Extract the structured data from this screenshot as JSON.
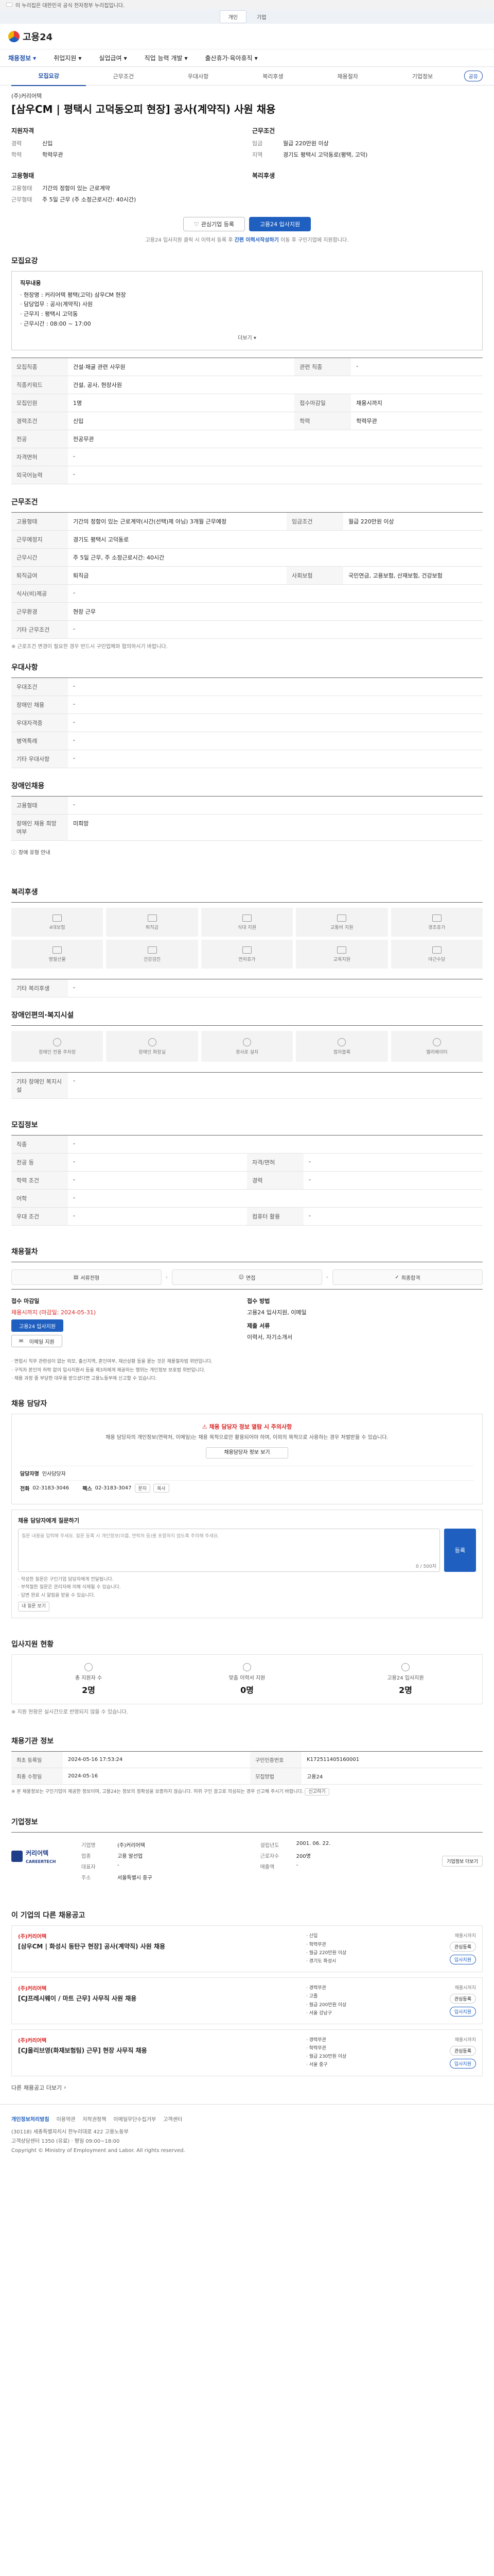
{
  "notice": "이 누리집은 대한민국 공식 전자정부 누리집입니다.",
  "gov_tabs": [
    "개인",
    "기업"
  ],
  "brand": "고용24",
  "gnb": [
    "채용정보",
    "취업지원",
    "실업급여",
    "직업 능력 개발",
    "출산휴가·육아휴직"
  ],
  "detail_tabs": [
    "모집요강",
    "근무조건",
    "우대사항",
    "복리후생",
    "채용절차",
    "기업정보"
  ],
  "share_label": "공유",
  "job": {
    "company": "(주)커리어텍",
    "title": "[삼우CM | 평택시 고덕동오피 현장] 공사(계약직) 사원 채용",
    "qualifications_title": "지원자격",
    "qualifications": [
      {
        "k": "경력",
        "v": "신입"
      },
      {
        "k": "학력",
        "v": "학력무관"
      }
    ],
    "conditions_title": "근무조건",
    "conditions": [
      {
        "k": "임금",
        "v": "월급 220만원 이상"
      },
      {
        "k": "지역",
        "v": "경기도 평택시 고덕동로(평택, 고덕)"
      }
    ],
    "employ_title": "고용형태",
    "employ": [
      {
        "k": "고용형태",
        "v": "기간의 정함이 있는 근로계약"
      },
      {
        "k": "근무형태",
        "v": "주 5일 근무 (주 소정근로시간: 40시간)"
      }
    ],
    "worktime_title": "복리후생",
    "btn_interest": "관심기업 등록",
    "btn_apply": "고용24 입사지원",
    "apply_note_prefix": "고용24 입사지원 클릭 시 이력서 등록 후 ",
    "apply_note_bold": "간편 이력서작성하기",
    "apply_note_suffix": " 이동 후 구인기업에 지원합니다."
  },
  "recruit": {
    "title": "모집요강",
    "duty_label": "직무내용",
    "duties": [
      "· 현장명 : 커리어텍 평택(고덕) 삼우CM 현장",
      "· 담당업무 : 공사(계약직) 사원",
      "· 근무지 : 평택시 고덕동",
      "· 근무시간 : 08:00 ~ 17:00"
    ],
    "toggle": "더보기",
    "table": [
      {
        "k": "모집직종",
        "v": "건설·채굴 관련 사무원",
        "k2": "관련 직종",
        "v2": "-"
      },
      {
        "k": "직종키워드",
        "v": "건설, 공사, 현장사원",
        "k2": "",
        "v2": ""
      },
      {
        "k": "모집인원",
        "v": "1명",
        "k2": "접수마감일",
        "v2": "채용시까지"
      },
      {
        "k": "경력조건",
        "v": "신입",
        "k2": "학력",
        "v2": "학력무관"
      },
      {
        "k": "전공",
        "v": "전공무관",
        "k2": "",
        "v2": ""
      },
      {
        "k": "자격면허",
        "v": "-",
        "k2": "",
        "v2": ""
      },
      {
        "k": "외국어능력",
        "v": "-",
        "k2": "",
        "v2": ""
      }
    ]
  },
  "work": {
    "title": "근무조건",
    "table": [
      {
        "k": "고용형태",
        "v": "기간의 정함이 있는 근로계약(시간(선택)제 아님) 3개월 근무예정",
        "k2": "임금조건",
        "v2": "월급 220만원 이상"
      },
      {
        "k": "근무예정지",
        "v": "경기도 평택시 고덕동로",
        "k2": "",
        "v2": ""
      },
      {
        "k": "근무시간",
        "v": "주 5일 근무, 주 소정근로시간: 40시간",
        "k2": "",
        "v2": ""
      },
      {
        "k": "퇴직급여",
        "v": "퇴직금",
        "k2": "사회보험",
        "v2": "국민연금, 고용보험, 산재보험, 건강보험"
      },
      {
        "k": "식사(비)제공",
        "v": "-",
        "k2": "",
        "v2": ""
      },
      {
        "k": "근무환경",
        "v": "현장 근무",
        "k2": "",
        "v2": ""
      },
      {
        "k": "기타 근무조건",
        "v": "-",
        "k2": "",
        "v2": ""
      }
    ],
    "note": "※ 근로조건 변경이 필요한 경우 반드시 구인업체와 협의하시기 바랍니다."
  },
  "pref": {
    "title": "우대사항",
    "table": [
      {
        "k": "우대조건",
        "v": "-"
      },
      {
        "k": "장애인 채용",
        "v": "-"
      },
      {
        "k": "우대자격증",
        "v": "-"
      },
      {
        "k": "병역특례",
        "v": "-"
      },
      {
        "k": "기타 우대사항",
        "v": "-"
      }
    ]
  },
  "disability": {
    "title": "장애인채용",
    "table": [
      {
        "k": "고용형태",
        "v": "-"
      },
      {
        "k": "장애인 채용 희망 여부",
        "v": "미희망"
      }
    ],
    "link": "장애 유형 안내"
  },
  "welfare": {
    "title": "복리후생",
    "items": [
      "4대보험",
      "퇴직금",
      "식대 지원",
      "교통비 지원",
      "경조휴가",
      "명절선물",
      "건강검진",
      "연차휴가",
      "교육지원",
      "야근수당"
    ],
    "other_label": "기타 복리후생",
    "other_value": "-"
  },
  "disabled_welfare": {
    "title": "장애인편의·복지시설",
    "items": [
      "장애인 전용 주차장",
      "장애인 화장실",
      "경사로 설치",
      "점자블록",
      "엘리베이터"
    ],
    "other_label": "기타 장애인 복지시설",
    "other_value": "-"
  },
  "company_size": {
    "title": "모집정보",
    "table": [
      {
        "k": "직종",
        "v": "-",
        "k2": "",
        "v2": ""
      },
      {
        "k": "전공 등",
        "v": "-",
        "k2": "자격/면허",
        "v2": "-"
      },
      {
        "k": "학력 조건",
        "v": "-",
        "k2": "경력",
        "v2": "-"
      },
      {
        "k": "어학",
        "v": "-",
        "k2": "",
        "v2": ""
      },
      {
        "k": "우대 조건",
        "v": "-",
        "k2": "컴퓨터 활용",
        "v2": "-"
      }
    ]
  },
  "process": {
    "title": "채용절차",
    "steps": [
      "서류전형",
      "면접",
      "최종합격"
    ],
    "apply_label": "접수 마감일",
    "apply_value": "채용시까지 (마감일: 2024-05-31)",
    "method_label": "접수 방법",
    "method_value": "고용24 입사지원, 이메일",
    "docs_label": "제출 서류",
    "docs_value": "이력서, 자기소개서",
    "btn_apply": "고용24 입사지원",
    "btn_email": "이메일 지원",
    "notes": [
      "· 면접시 직무 관련성이 없는 외모, 출신지역, 혼인여부, 재산상황 등을 묻는 것은 채용절차법 위반입니다.",
      "· 구직자 본인의 허락 없이 입사지원서 등을 제3자에게 제공하는 행위는 개인정보 보호법 위반입니다.",
      "· 채용 과정 중 부당한 대우를 받으셨다면 고용노동부에 신고할 수 있습니다."
    ]
  },
  "contact": {
    "title": "채용 담당자",
    "alert_title": "채용 담당자 정보 열람 시 주의사항",
    "alert_text": "채용 담당자의 개인정보(연락처, 이메일)는 채용 목적으로만 활용되어야 하며, 이외의 목적으로 사용하는 경우 처벌받을 수 있습니다.",
    "btn": "채용담당자 정보 보기",
    "manager_label": "담당자명",
    "manager_value": "인사담당자",
    "phone_label": "전화",
    "phone_value": "02-3183-3046",
    "fax_label": "팩스",
    "fax_value": "02-3183-3047",
    "chips": [
      "문자",
      "복사"
    ]
  },
  "qna": {
    "title": "채용 담당자에게 질문하기",
    "placeholder": "질문 내용을 입력해 주세요. 질문 등록 시 개인정보(이름, 연락처 등)를 포함하지 않도록 주의해 주세요.",
    "count": "0 / 500자",
    "btn": "등록",
    "notes": [
      "· 작성한 질문은 구인기업 담당자에게 전달됩니다.",
      "· 부적절한 질문은 관리자에 의해 삭제될 수 있습니다.",
      "· 답변 완료 시 알림을 받을 수 있습니다."
    ],
    "my_btn": "내 질문 보기"
  },
  "stats": {
    "title": "입사지원 현황",
    "items": [
      {
        "label": "총 지원자 수",
        "value": "2명"
      },
      {
        "label": "맞춤 이력서 지원",
        "value": "0명"
      },
      {
        "label": "고용24 입사지원",
        "value": "2명"
      }
    ],
    "note": "※ 지원 현황은 실시간으로 반영되지 않을 수 있습니다."
  },
  "meta": {
    "title": "채용기관 정보",
    "rows": [
      {
        "k": "최초 등록일",
        "v": "2024-05-16 17:53:24",
        "k2": "구인인증번호",
        "v2": "K172511405160001"
      },
      {
        "k": "최종 수정일",
        "v": "2024-05-16",
        "k2": "모집방법",
        "v2": "고용24"
      }
    ],
    "note": "※ 본 채용정보는 구인기업이 제공한 정보이며, 고용24는 정보의 정확성을 보증하지 않습니다. 허위 구인 광고로 의심되는 경우 신고해 주시기 바랍니다.",
    "report_btn": "신고하기"
  },
  "company": {
    "title": "기업정보",
    "logo_text": "커리어텍",
    "logo_sub": "CAREERTECH",
    "rows": [
      {
        "k": "기업명",
        "v": "(주)커리어텍",
        "k2": "설립년도",
        "v2": "2001. 06. 22."
      },
      {
        "k": "업종",
        "v": "고용 알선업",
        "k2": "근로자수",
        "v2": "200명"
      },
      {
        "k": "대표자",
        "v": "-",
        "k2": "매출액",
        "v2": "-"
      },
      {
        "k": "주소",
        "v": "서울특별시 중구",
        "k2": "",
        "v2": ""
      }
    ],
    "cta": "기업정보 더보기"
  },
  "related": {
    "title": "이 기업의 다른 채용공고",
    "items": [
      {
        "company": "(주)커리어텍",
        "title": "[삼우CM | 화성시 동탄구 현장] 공사(계약직) 사원 채용",
        "meta": [
          "· 신입",
          "· 학력무관",
          "· 월급 220만원 이상",
          "· 경기도 화성시"
        ],
        "dday": "채용시까지"
      },
      {
        "company": "(주)커리어텍",
        "title": "[CJ프레시웨이 / 마트 근무] 사무직 사원 채용",
        "meta": [
          "· 경력무관",
          "· 고졸",
          "· 월급 200만원 이상",
          "· 서울 강남구"
        ],
        "dday": "채용시까지"
      },
      {
        "company": "(주)커리어텍",
        "title": "[CJ올리브영(화재보험팀) 근무] 현장 사무직 채용",
        "meta": [
          "· 경력무관",
          "· 학력무관",
          "· 월급 230만원 이상",
          "· 서울 중구"
        ],
        "dday": "채용시까지"
      }
    ],
    "btn_save": "관심등록",
    "btn_apply": "입사지원",
    "more_link": "다른 채용공고 더보기"
  },
  "footer": {
    "links": [
      "개인정보처리방침",
      "이용약관",
      "저작권정책",
      "이메일무단수집거부",
      "고객센터"
    ],
    "addr1": "(30118) 세종특별자치시 한누리대로 422 고용노동부",
    "addr2": "고객상담센터 1350 (유료) · 평일 09:00~18:00",
    "copy": "Copyright © Ministry of Employment and Labor. All rights reserved."
  }
}
